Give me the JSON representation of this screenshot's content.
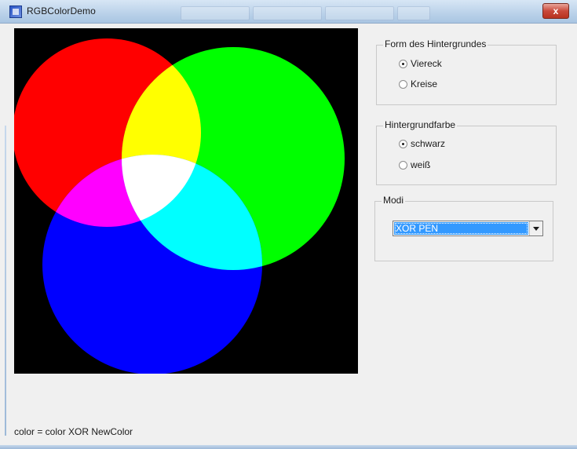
{
  "window": {
    "title": "RGBColorDemo",
    "close_glyph": "x"
  },
  "canvas": {
    "background_color": "#000000",
    "circles": [
      {
        "name": "red-circle",
        "color": "#ff0000"
      },
      {
        "name": "green-circle",
        "color": "#00ff00"
      },
      {
        "name": "blue-circle",
        "color": "#0000ff"
      }
    ]
  },
  "form_group": {
    "label": "Form des Hintergrundes",
    "options": [
      {
        "label": "Viereck",
        "checked": true
      },
      {
        "label": "Kreise",
        "checked": false
      }
    ]
  },
  "background_group": {
    "label": "Hintergrundfarbe",
    "options": [
      {
        "label": "schwarz",
        "checked": true
      },
      {
        "label": "weiß",
        "checked": false
      }
    ]
  },
  "modes_group": {
    "label": "Modi",
    "selected": "XOR PEN"
  },
  "status": {
    "text": "color = color XOR NewColor"
  },
  "icons": [
    "app-icon",
    "close-icon",
    "dropdown-arrow-icon"
  ]
}
